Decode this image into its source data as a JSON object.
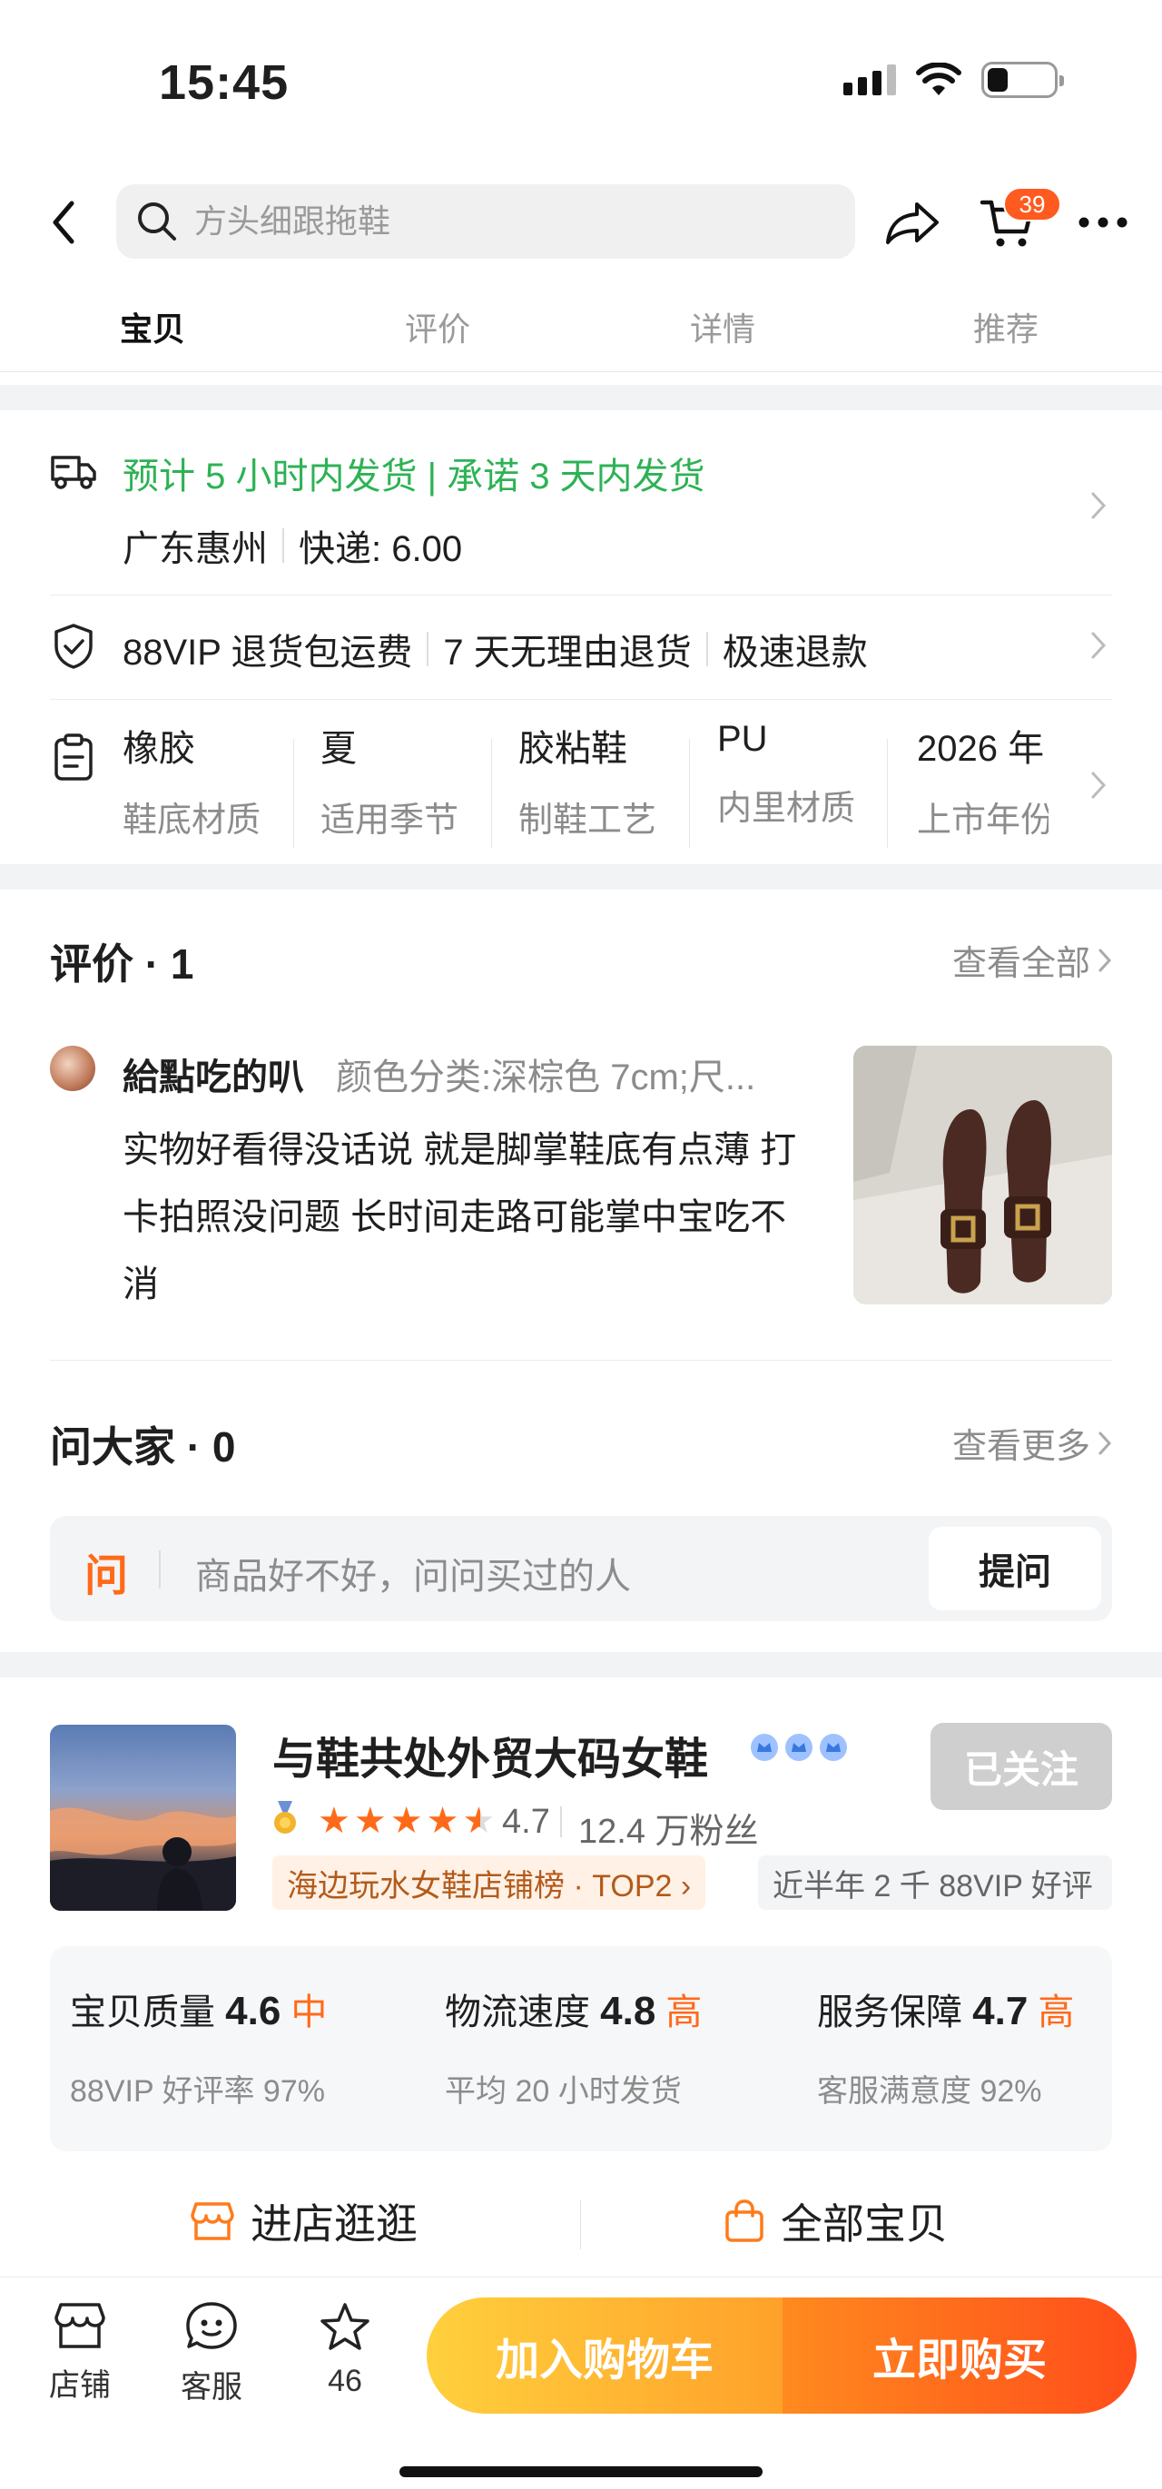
{
  "status_bar": {
    "time": "15:45"
  },
  "header": {
    "search_placeholder": "方头细跟拖鞋",
    "cart_count": "39"
  },
  "tabs": [
    {
      "label": "宝贝",
      "active": true
    },
    {
      "label": "评价",
      "active": false
    },
    {
      "label": "详情",
      "active": false
    },
    {
      "label": "推荐",
      "active": false
    }
  ],
  "shipping": {
    "promise": "预计 5 小时内发货 | 承诺 3 天内发货",
    "origin": "广东惠州",
    "fee": "快递: 6.00"
  },
  "service": {
    "items": [
      "88VIP 退货包运费",
      "7 天无理由退货",
      "极速退款"
    ]
  },
  "params": [
    {
      "value": "橡胶",
      "key": "鞋底材质"
    },
    {
      "value": "夏",
      "key": "适用季节"
    },
    {
      "value": "胶粘鞋",
      "key": "制鞋工艺"
    },
    {
      "value": "PU",
      "key": "内里材质"
    },
    {
      "value": "2026 年",
      "key": "上市年份"
    }
  ],
  "reviews": {
    "title": "评价 · 1",
    "see_all": "查看全部",
    "item": {
      "user": "給點吃的叭",
      "sku": "颜色分类:深棕色 7cm;尺...",
      "text": "实物好看得没话说 就是脚掌鞋底有点薄 打卡拍照没问题 长时间走路可能掌中宝吃不消"
    }
  },
  "qa": {
    "title": "问大家 · 0",
    "see_more": "查看更多",
    "mark": "问",
    "placeholder": "商品好不好，问问买过的人",
    "ask_button": "提问"
  },
  "shop": {
    "name": "与鞋共处外贸大码女鞋",
    "follow_label": "已关注",
    "rating": "4.7",
    "fans": "12.4 万粉丝",
    "rank_tag": "海边玩水女鞋店铺榜 · TOP2 ›",
    "vip_tag": "近半年 2 千 88VIP 好评",
    "scores": [
      {
        "label": "宝贝质量",
        "score": "4.6",
        "level": "中",
        "sub": "88VIP 好评率 97%"
      },
      {
        "label": "物流速度",
        "score": "4.8",
        "level": "高",
        "sub": "平均 20 小时发货"
      },
      {
        "label": "服务保障",
        "score": "4.7",
        "level": "高",
        "sub": "客服满意度 92%"
      }
    ],
    "enter_store": "进店逛逛",
    "all_items": "全部宝贝"
  },
  "bottom_bar": {
    "store": "店铺",
    "service": "客服",
    "favorites": "46",
    "add_to_cart": "加入购物车",
    "buy_now": "立即购买"
  },
  "colors": {
    "accent": "#ff6a1a",
    "green": "#2db255",
    "cart_gradient_start": "#ffd03d",
    "buy_gradient_end": "#ff4d1a"
  }
}
